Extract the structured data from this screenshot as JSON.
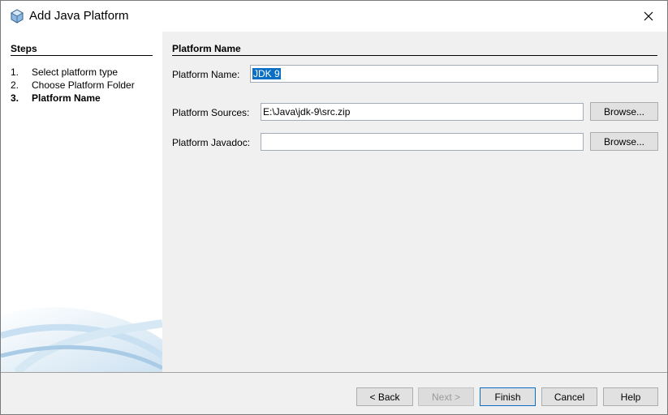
{
  "window": {
    "title": "Add Java Platform",
    "close_glyph": "✕"
  },
  "steps": {
    "title": "Steps",
    "items": [
      {
        "num": "1.",
        "label": "Select platform type"
      },
      {
        "num": "2.",
        "label": "Choose Platform Folder"
      },
      {
        "num": "3.",
        "label": "Platform Name"
      }
    ],
    "current_index": 2
  },
  "content": {
    "title": "Platform Name",
    "platform_name_label": "Platform Name:",
    "platform_name_value": "JDK 9",
    "platform_sources_label": "Platform Sources:",
    "platform_sources_value": "E:\\Java\\jdk-9\\src.zip",
    "platform_javadoc_label": "Platform Javadoc:",
    "platform_javadoc_value": "",
    "browse_label": "Browse..."
  },
  "footer": {
    "back": "< Back",
    "next": "Next >",
    "finish": "Finish",
    "cancel": "Cancel",
    "help": "Help"
  },
  "colors": {
    "accent": "#0a6ec4",
    "selection": "#0a6ec4"
  }
}
